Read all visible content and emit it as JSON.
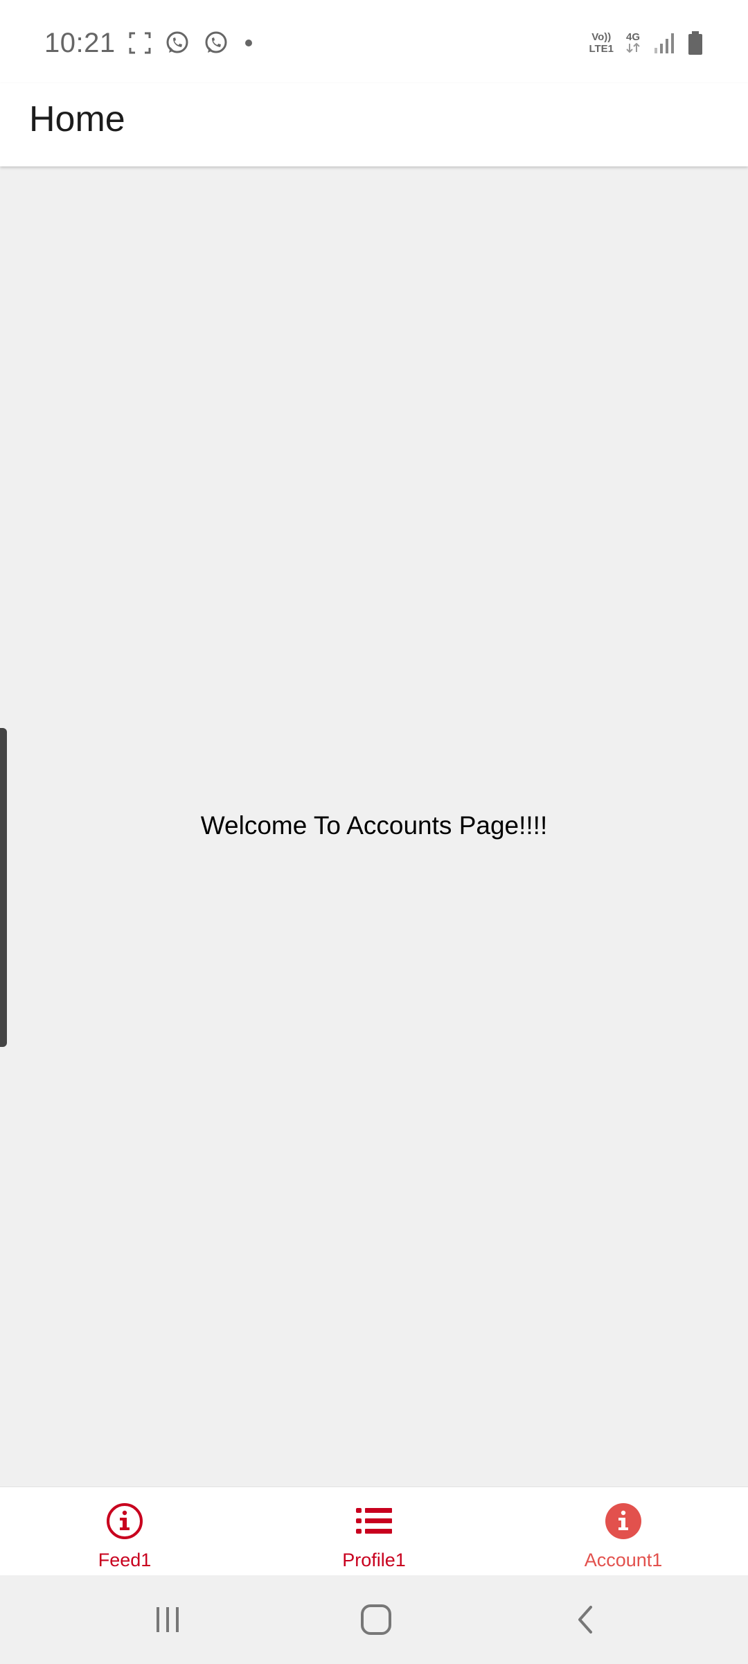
{
  "status_bar": {
    "time": "10:21",
    "volte_line1": "Vo))",
    "volte_line2": "LTE1",
    "network_type": "4G",
    "left_icons": [
      "screenshot-icon",
      "whatsapp-icon",
      "whatsapp-icon",
      "dot-icon"
    ],
    "right_icons": [
      "signal-icon",
      "battery-icon"
    ]
  },
  "app_bar": {
    "title": "Home"
  },
  "content": {
    "message": "Welcome To Accounts Page!!!!"
  },
  "bottom_nav": {
    "items": [
      {
        "label": "Feed1",
        "icon": "info-outline-icon",
        "color": "#c8001e"
      },
      {
        "label": "Profile1",
        "icon": "list-icon",
        "color": "#c8001e"
      },
      {
        "label": "Account1",
        "icon": "info-filled-icon",
        "color": "#e2514d"
      }
    ]
  },
  "system_nav": {
    "icons": [
      "recents-icon",
      "home-icon",
      "back-icon"
    ]
  },
  "colors": {
    "accent": "#c8001e",
    "accent_light": "#e2514d",
    "background": "#f0f0f0",
    "surface": "#ffffff"
  }
}
